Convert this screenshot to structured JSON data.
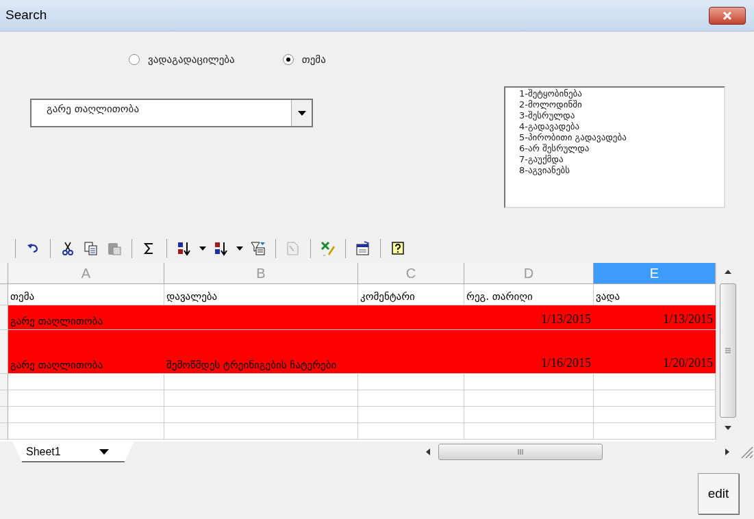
{
  "window": {
    "title": "Search"
  },
  "radios": [
    {
      "label": "ვადაგადაცილება",
      "selected": false
    },
    {
      "label": "თემა",
      "selected": true
    }
  ],
  "dropdown": {
    "value": "გარე თაღლითობა"
  },
  "status_list": [
    "1-შეტყობინება",
    "2-მოლოდინში",
    "3-შესრულდა",
    "4-გადავადება",
    "5-პირობითი გადავადება",
    "6-არ შესრულდა",
    "7-გაუქმდა",
    "8-აგვიანებს"
  ],
  "sheet": {
    "columns": [
      {
        "letter": "A",
        "selected": false
      },
      {
        "letter": "B",
        "selected": false
      },
      {
        "letter": "C",
        "selected": false
      },
      {
        "letter": "D",
        "selected": false
      },
      {
        "letter": "E",
        "selected": true
      }
    ],
    "rows": [
      {
        "highlighted": false,
        "cells": [
          "თემა",
          "დავალება",
          "კომენტარი",
          "რეგ. თარიღი",
          "ვადა"
        ]
      },
      {
        "highlighted": true,
        "cells": [
          "გარე თაღლითობა",
          "",
          "",
          "1/13/2015",
          "1/13/2015"
        ]
      },
      {
        "highlighted": true,
        "tall": true,
        "cells": [
          "გარე თაღლითობა",
          "შემოწმდეს ტრეინიგების ჩატერები",
          "",
          "1/16/2015",
          "1/20/2015"
        ]
      }
    ],
    "tab": "Sheet1"
  },
  "buttons": [
    "edit"
  ]
}
